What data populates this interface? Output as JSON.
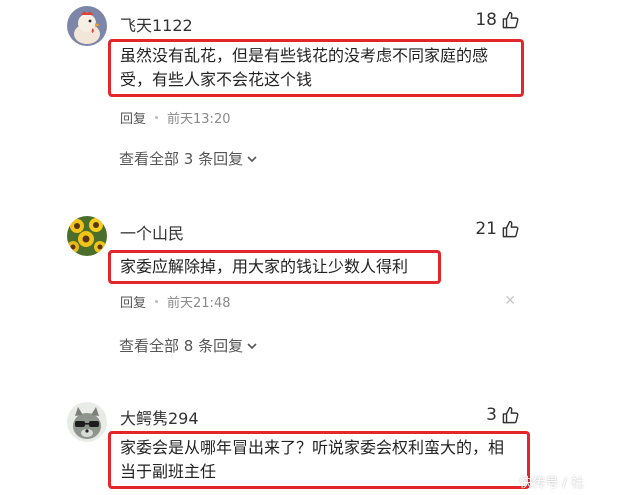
{
  "comments": [
    {
      "username": "飞天1122",
      "likes": "18",
      "text": "虽然没有乱花，但是有些钱花的没考虑不同家庭的感受，有些人家不会花这个钱",
      "reply_label": "回复",
      "time": "前天13:20",
      "view_replies": "查看全部 3 条回复",
      "avatar_icon": "rooster-avatar-icon",
      "show_close": false
    },
    {
      "username": "一个山民",
      "likes": "21",
      "text": "家委应解除掉，用大家的钱让少数人得利",
      "reply_label": "回复",
      "time": "前天21:48",
      "view_replies": "查看全部 8 条回复",
      "avatar_icon": "sunflower-avatar-icon",
      "show_close": true
    },
    {
      "username": "大鳄隽294",
      "likes": "3",
      "text": "家委会是从哪年冒出来了？听说家委会权利蛮大的，相当于副班主任",
      "avatar_icon": "raccoon-avatar-icon"
    }
  ],
  "icons": {
    "like": "thumbs-up-icon",
    "close": "close-icon",
    "chevron": "chevron-down-icon"
  },
  "watermark": "快传号 / 社"
}
